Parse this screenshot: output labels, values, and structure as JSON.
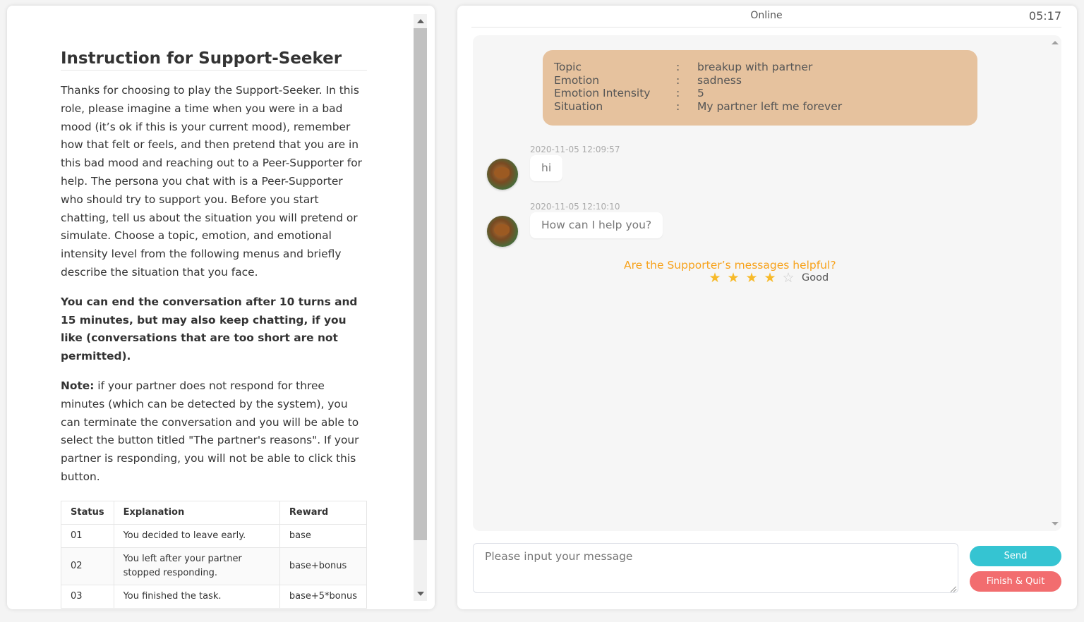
{
  "instructions": {
    "title": "Instruction for Support-Seeker",
    "para1": "Thanks for choosing to play the Support-Seeker. In this role, please imagine a time when you were in a bad mood (it’s ok if this is your current mood), remember how that felt or feels, and then pretend that you are in this bad mood and reaching out to a Peer-Supporter for help. The persona you chat with is a Peer-Supporter who should try to support you. Before you start chatting, tell us about the situation you will pretend or simulate. Choose a topic, emotion, and emotional intensity level from the following menus and briefly describe the situation that you face.",
    "para2": "You can end the conversation after 10 turns and 15 minutes, but may also keep chatting, if you like (conversations that are too short are not permitted).",
    "note_label": "Note:",
    "note_text": " if your partner does not respond for three minutes (which can be detected by the system), you can terminate the conversation and you will be able to select the button titled \"The partner's reasons\". If your partner is responding, you will not be able to click this button.",
    "table": {
      "headers": [
        "Status",
        "Explanation",
        "Reward"
      ],
      "rows": [
        [
          "01",
          "You decided to leave early.",
          "base"
        ],
        [
          "02",
          "You left after your partner stopped responding.",
          "base+bonus"
        ],
        [
          "03",
          "You finished the task.",
          "base+5*bonus"
        ]
      ]
    }
  },
  "chat": {
    "status": "Online",
    "timer": "05:17",
    "info": {
      "rows": [
        {
          "key": "Topic",
          "sep": ":",
          "value": "breakup with partner"
        },
        {
          "key": "Emotion",
          "sep": ":",
          "value": "sadness"
        },
        {
          "key": "Emotion Intensity",
          "sep": ":",
          "value": "5"
        },
        {
          "key": "Situation",
          "sep": ":",
          "value": "My partner left me forever"
        }
      ]
    },
    "messages": [
      {
        "time": "2020-11-05 12:09:57",
        "text": "hi"
      },
      {
        "time": "2020-11-05 12:10:10",
        "text": "How can I help you?"
      }
    ],
    "rating": {
      "question": "Are the Supporter’s messages helpful?",
      "stars": 4,
      "max_stars": 5,
      "label": "Good",
      "star_color": "#f7ba2a"
    },
    "input_placeholder": "Please input your message",
    "send_label": "Send",
    "quit_label": "Finish & Quit",
    "colors": {
      "info_card": "#e6c29e",
      "send": "#35c4d2",
      "quit": "#f26d6f",
      "rating_question": "#f7a21b"
    }
  }
}
